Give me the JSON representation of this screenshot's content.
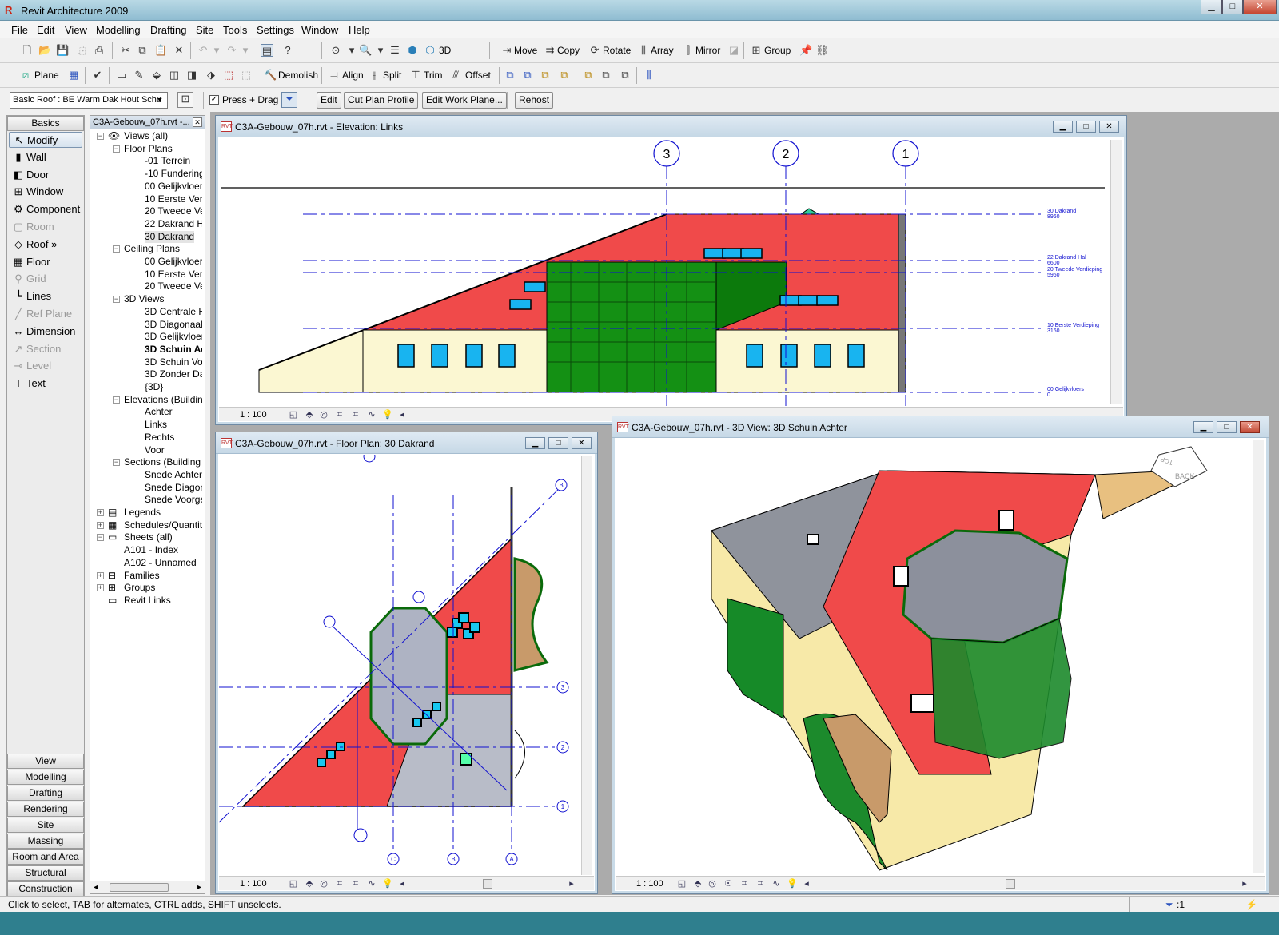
{
  "app": {
    "title": "Revit Architecture 2009",
    "min": "▁",
    "max": "□",
    "close": "✕"
  },
  "menu": [
    "File",
    "Edit",
    "View",
    "Modelling",
    "Drafting",
    "Site",
    "Tools",
    "Settings",
    "Window",
    "Help"
  ],
  "toolbar1": {
    "items": [
      "Move",
      "Copy",
      "Rotate",
      "Array",
      "Mirror",
      "Group"
    ],
    "view3d": "3D"
  },
  "toolbar2": {
    "plane": "Plane",
    "demolish": "Demolish",
    "align": "Align",
    "split": "Split",
    "trim": "Trim",
    "offset": "Offset"
  },
  "options": {
    "type_selector": "Basic Roof : BE Warm Dak Hout Schu",
    "press_drag": "Press + Drag",
    "press_drag_checked": "✓",
    "edit": "Edit",
    "cut_profile": "Cut Plan Profile",
    "edit_work_plane": "Edit Work Plane...",
    "rehost": "Rehost"
  },
  "design_bar": {
    "tab": "Basics",
    "items": [
      {
        "label": "Modify",
        "icon": "↖",
        "enabled": true
      },
      {
        "label": "Wall",
        "icon": "▮",
        "enabled": true
      },
      {
        "label": "Door",
        "icon": "◧",
        "enabled": true
      },
      {
        "label": "Window",
        "icon": "⊞",
        "enabled": true
      },
      {
        "label": "Component",
        "icon": "⚙",
        "enabled": true
      },
      {
        "label": "Room",
        "icon": "▢",
        "enabled": false
      },
      {
        "label": "Roof »",
        "icon": "◇",
        "enabled": true
      },
      {
        "label": "Floor",
        "icon": "▦",
        "enabled": true
      },
      {
        "label": "Grid",
        "icon": "⚲",
        "enabled": false
      },
      {
        "label": "Lines",
        "icon": "┗",
        "enabled": true
      },
      {
        "label": "Ref Plane",
        "icon": "╱",
        "enabled": false
      },
      {
        "label": "Dimension",
        "icon": "↔",
        "enabled": true
      },
      {
        "label": "Section",
        "icon": "↗",
        "enabled": false
      },
      {
        "label": "Level",
        "icon": "⊸",
        "enabled": false
      },
      {
        "label": "Text",
        "icon": "T",
        "enabled": true
      }
    ],
    "tabs": [
      "View",
      "Modelling",
      "Drafting",
      "Rendering",
      "Site",
      "Massing",
      "Room and Area",
      "Structural",
      "Construction"
    ]
  },
  "browser": {
    "title": "C3A-Gebouw_07h.rvt -...",
    "nodes": [
      {
        "label": "Views (all)",
        "lvl": 0,
        "exp": "−",
        "icon": "👁"
      },
      {
        "label": "Floor Plans",
        "lvl": 1,
        "exp": "−"
      },
      {
        "label": "-01 Terrein",
        "lvl": 2
      },
      {
        "label": "-10 Fundering",
        "lvl": 2
      },
      {
        "label": "00 Gelijkvloers",
        "lvl": 2
      },
      {
        "label": "10 Eerste Verdie",
        "lvl": 2
      },
      {
        "label": "20 Tweede Verc",
        "lvl": 2
      },
      {
        "label": "22 Dakrand Ha",
        "lvl": 2
      },
      {
        "label": "30 Dakrand",
        "lvl": 2,
        "hl": true
      },
      {
        "label": "Ceiling Plans",
        "lvl": 1,
        "exp": "−"
      },
      {
        "label": "00 Gelijkvloers",
        "lvl": 2
      },
      {
        "label": "10 Eerste Verdie",
        "lvl": 2
      },
      {
        "label": "20 Tweede Verc",
        "lvl": 2
      },
      {
        "label": "3D Views",
        "lvl": 1,
        "exp": "−"
      },
      {
        "label": "3D Centrale Ha",
        "lvl": 2
      },
      {
        "label": "3D Diagonaal",
        "lvl": 2
      },
      {
        "label": "3D Gelijkvloers",
        "lvl": 2
      },
      {
        "label": "3D Schuin Ac",
        "lvl": 2,
        "bold": true
      },
      {
        "label": "3D Schuin Voo",
        "lvl": 2
      },
      {
        "label": "3D Zonder Dal",
        "lvl": 2
      },
      {
        "label": "{3D}",
        "lvl": 2
      },
      {
        "label": "Elevations (Building",
        "lvl": 1,
        "exp": "−"
      },
      {
        "label": "Achter",
        "lvl": 2
      },
      {
        "label": "Links",
        "lvl": 2
      },
      {
        "label": "Rechts",
        "lvl": 2
      },
      {
        "label": "Voor",
        "lvl": 2
      },
      {
        "label": "Sections (Building S",
        "lvl": 1,
        "exp": "−"
      },
      {
        "label": "Snede Achterge",
        "lvl": 2
      },
      {
        "label": "Snede Diagona",
        "lvl": 2
      },
      {
        "label": "Snede Voorgev",
        "lvl": 2
      },
      {
        "label": "Legends",
        "lvl": 0,
        "exp": "+",
        "icon": "▤"
      },
      {
        "label": "Schedules/Quantitie",
        "lvl": 0,
        "exp": "+",
        "icon": "▦"
      },
      {
        "label": "Sheets (all)",
        "lvl": 0,
        "exp": "−",
        "icon": "▭"
      },
      {
        "label": "A101 - Index",
        "lvl": 1
      },
      {
        "label": "A102 - Unnamed",
        "lvl": 1
      },
      {
        "label": "Families",
        "lvl": 0,
        "exp": "+",
        "icon": "⊟"
      },
      {
        "label": "Groups",
        "lvl": 0,
        "exp": "+",
        "icon": "⊞"
      },
      {
        "label": "Revit Links",
        "lvl": 0,
        "icon": "▭"
      }
    ]
  },
  "views": {
    "elevation": {
      "title": "C3A-Gebouw_07h.rvt - Elevation: Links",
      "scale": "1 : 100",
      "grids": [
        "3",
        "2",
        "1"
      ],
      "levels": [
        {
          "name": "30 Dakrand",
          "value": "8960"
        },
        {
          "name": "22 Dakrand Hal",
          "value": "6600"
        },
        {
          "name": "20 Tweede Verdieping",
          "value": "5960"
        },
        {
          "name": "10 Eerste Verdieping",
          "value": "3160"
        },
        {
          "name": "00 Gelijkvloers",
          "value": "0"
        }
      ]
    },
    "floorplan": {
      "title": "C3A-Gebouw_07h.rvt - Floor Plan: 30 Dakrand",
      "scale": "1 : 100",
      "grids_h": [
        "3",
        "2",
        "1"
      ],
      "grids_v": [
        "C",
        "B",
        "A"
      ],
      "grid_b": "B"
    },
    "view3d": {
      "title": "C3A-Gebouw_07h.rvt - 3D View: 3D Schuin Achter",
      "scale": "1 : 100",
      "cube_top": "TOP",
      "cube_back": "BACK"
    }
  },
  "status": {
    "text": "Click to select, TAB for alternates, CTRL adds, SHIFT unselects.",
    "filter": ":1"
  }
}
